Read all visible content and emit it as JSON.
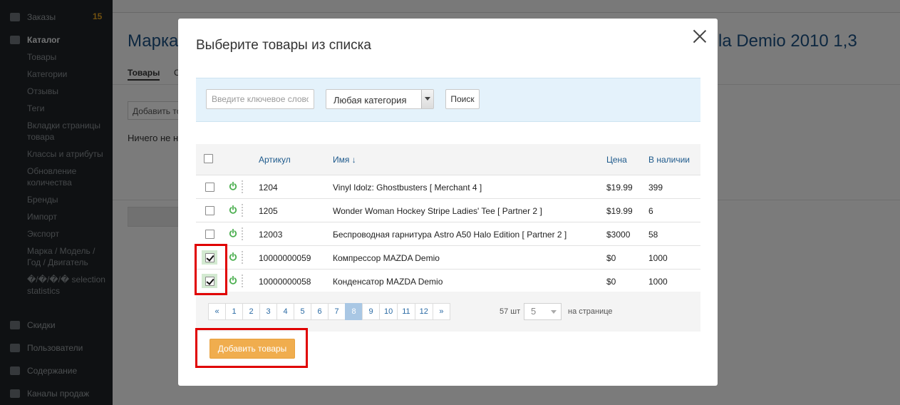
{
  "background": {
    "sidebar": {
      "items": [
        {
          "label": "Заказы",
          "badge": "15"
        },
        {
          "label": "Каталог"
        },
        {
          "label": "Товары"
        },
        {
          "label": "Категории"
        },
        {
          "label": "Отзывы"
        },
        {
          "label": "Теги"
        },
        {
          "label": "Вкладки страницы товара"
        },
        {
          "label": "Классы и атрибуты"
        },
        {
          "label": "Обновление количества"
        },
        {
          "label": "Бренды"
        },
        {
          "label": "Импорт"
        },
        {
          "label": "Экспорт"
        },
        {
          "label": "Марка / Модель / Год / Двигатель"
        },
        {
          "label": "�/�/�/� selection statistics"
        },
        {
          "label": "Скидки"
        },
        {
          "label": "Пользователи"
        },
        {
          "label": "Содержание"
        },
        {
          "label": "Каналы продаж"
        }
      ]
    },
    "page_title_left": "Марка",
    "page_title_right": "la Demio 2010 1,3",
    "tabs": [
      "Товары",
      "С"
    ],
    "add_button": "Добавить то",
    "empty_text": "Ничего не н"
  },
  "modal": {
    "title": "Выберите товары из списка",
    "search": {
      "placeholder": "Введите ключевое слово",
      "category": "Любая категория",
      "button": "Поиск"
    },
    "columns": {
      "sku": "Артикул",
      "name": "Имя ↓",
      "price": "Цена",
      "stock": "В наличии"
    },
    "rows": [
      {
        "sku": "1204",
        "name": "Vinyl Idolz: Ghostbusters [ Merchant 4 ]",
        "price": "$19.99",
        "stock": "399",
        "checked": false
      },
      {
        "sku": "1205",
        "name": "Wonder Woman Hockey Stripe Ladies' Tee [ Partner 2 ]",
        "price": "$19.99",
        "stock": "6",
        "checked": false
      },
      {
        "sku": "12003",
        "name": "Беспроводная гарнитура Astro A50 Halo Edition [ Partner 2 ]",
        "price": "$3000",
        "stock": "58",
        "checked": false
      },
      {
        "sku": "10000000059",
        "name": "Компрессор MAZDA Demio",
        "price": "$0",
        "stock": "1000",
        "checked": true
      },
      {
        "sku": "10000000058",
        "name": "Конденсатор MAZDA Demio",
        "price": "$0",
        "stock": "1000",
        "checked": true
      }
    ],
    "pagination": {
      "pages": [
        "«",
        "1",
        "2",
        "3",
        "4",
        "5",
        "6",
        "7",
        "8",
        "9",
        "10",
        "11",
        "12",
        "»"
      ],
      "current": "8",
      "total": "57 шт",
      "per_page": "5",
      "per_page_label": "на странице"
    },
    "add_button": "Добавить товары"
  },
  "colors": {
    "highlight": "#e00000",
    "accent_button": "#f0ad4e",
    "power_icon": "#4caf50",
    "link": "#1e5a8c"
  }
}
